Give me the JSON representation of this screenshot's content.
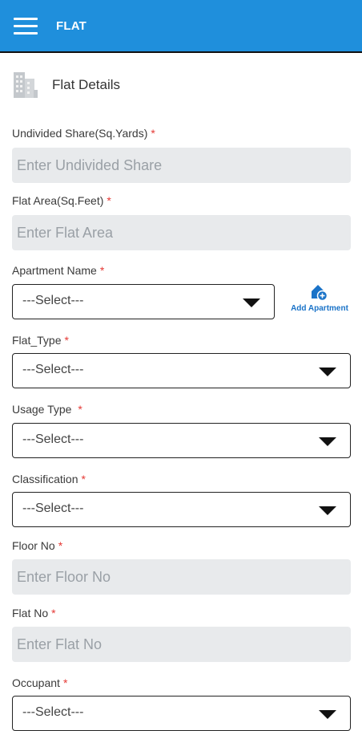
{
  "appbar": {
    "title": "FLAT",
    "menu_icon": "hamburger-menu-icon"
  },
  "section": {
    "title": "Flat Details",
    "icon": "building-icon"
  },
  "required_mark": "*",
  "fields": {
    "undivided_share": {
      "label": "Undivided Share(Sq.Yards)",
      "placeholder": "Enter Undivided Share"
    },
    "flat_area": {
      "label": "Flat Area(Sq.Feet)",
      "placeholder": "Enter Flat Area"
    },
    "apartment_name": {
      "label": "Apartment Name",
      "value": "---Select---"
    },
    "flat_type": {
      "label": "Flat_Type",
      "value": "---Select---"
    },
    "usage_type": {
      "label": "Usage Type ",
      "value": "---Select---"
    },
    "classification": {
      "label": "Classification",
      "value": "---Select---"
    },
    "floor_no": {
      "label": "Floor No",
      "placeholder": "Enter Floor No"
    },
    "flat_no": {
      "label": "Flat No",
      "placeholder": "Enter Flat No"
    },
    "occupant": {
      "label": "Occupant",
      "value": "---Select---"
    }
  },
  "add_apartment": {
    "label": "Add Apartment",
    "icon": "add-home-icon"
  },
  "colors": {
    "primary": "#1f8fdc",
    "link": "#1a73c8",
    "required": "#e53935",
    "field_bg": "#e8eaec"
  }
}
